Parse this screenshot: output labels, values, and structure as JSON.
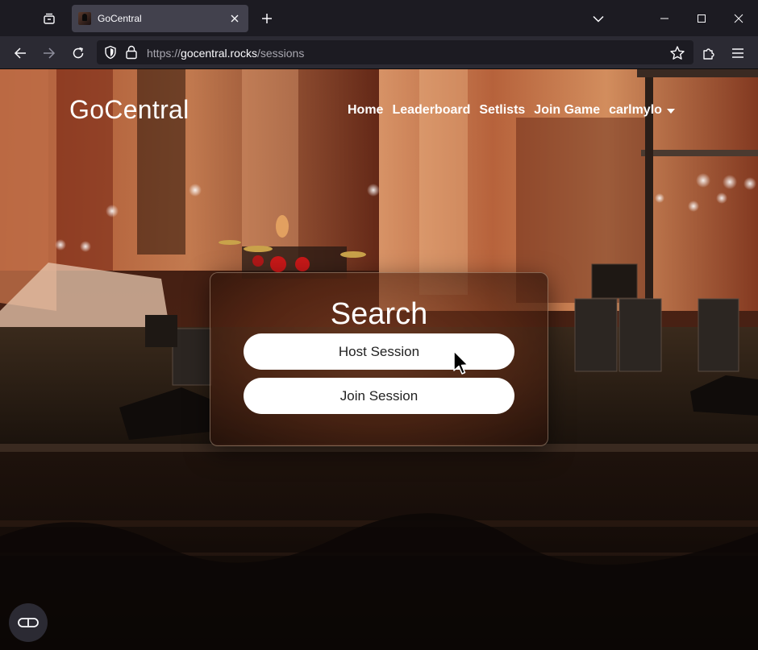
{
  "browser": {
    "tab": {
      "title": "GoCentral"
    },
    "url": {
      "prefix": "https://",
      "host": "gocentral.rocks",
      "path": "/sessions"
    },
    "icons": {
      "tab_overview": "tab-overview-icon",
      "tab_close": "close-icon",
      "new_tab": "plus-icon",
      "tab_list": "chevron-down-icon",
      "minimize": "minimize-icon",
      "maximize": "maximize-icon",
      "close_window": "close-icon",
      "back": "back-arrow-icon",
      "forward": "forward-arrow-icon",
      "reload": "reload-icon",
      "tracking": "shield-icon",
      "lock": "lock-icon",
      "bookmark": "star-icon",
      "extensions": "puzzle-icon",
      "menu": "hamburger-menu-icon"
    },
    "colors": {
      "tabbar": "#1c1b22",
      "navbar": "#2b2a33",
      "active_tab": "#42414d"
    }
  },
  "site": {
    "brand": "GoCentral",
    "nav": {
      "home": "Home",
      "leaderboard": "Leaderboard",
      "setlists": "Setlists",
      "join_game": "Join Game",
      "user": "carlmylo"
    }
  },
  "card": {
    "title": "Search",
    "host_button": "Host Session",
    "join_button": "Join Session"
  },
  "reader_view_icon": "reader-view-icon"
}
